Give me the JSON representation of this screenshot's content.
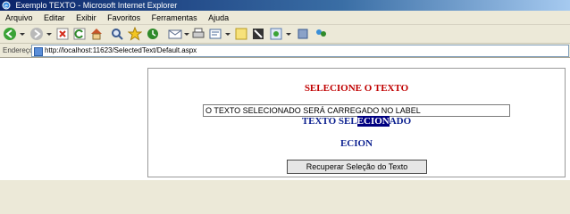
{
  "window": {
    "title": "Exemplo TEXTO - Microsoft Internet Explorer"
  },
  "menu": [
    "Arquivo",
    "Editar",
    "Exibir",
    "Favoritos",
    "Ferramentas",
    "Ajuda"
  ],
  "address": {
    "label": "Endereço",
    "url": "http://localhost:11623/SelectedText/Default.aspx"
  },
  "page": {
    "heading": "SELECIONE O TEXTO",
    "textbox_value": "O TEXTO SELECIONADO SERÁ CARREGADO NO LABEL",
    "label_prefix": "TEXTO SEL",
    "label_selected": "ECION",
    "label_suffix": "ADO",
    "result": "ECION",
    "button": "Recuperar Seleção do Texto"
  },
  "colors": {
    "heading": "#c00000",
    "label": "#0a1f8f",
    "selection": "#000080"
  }
}
